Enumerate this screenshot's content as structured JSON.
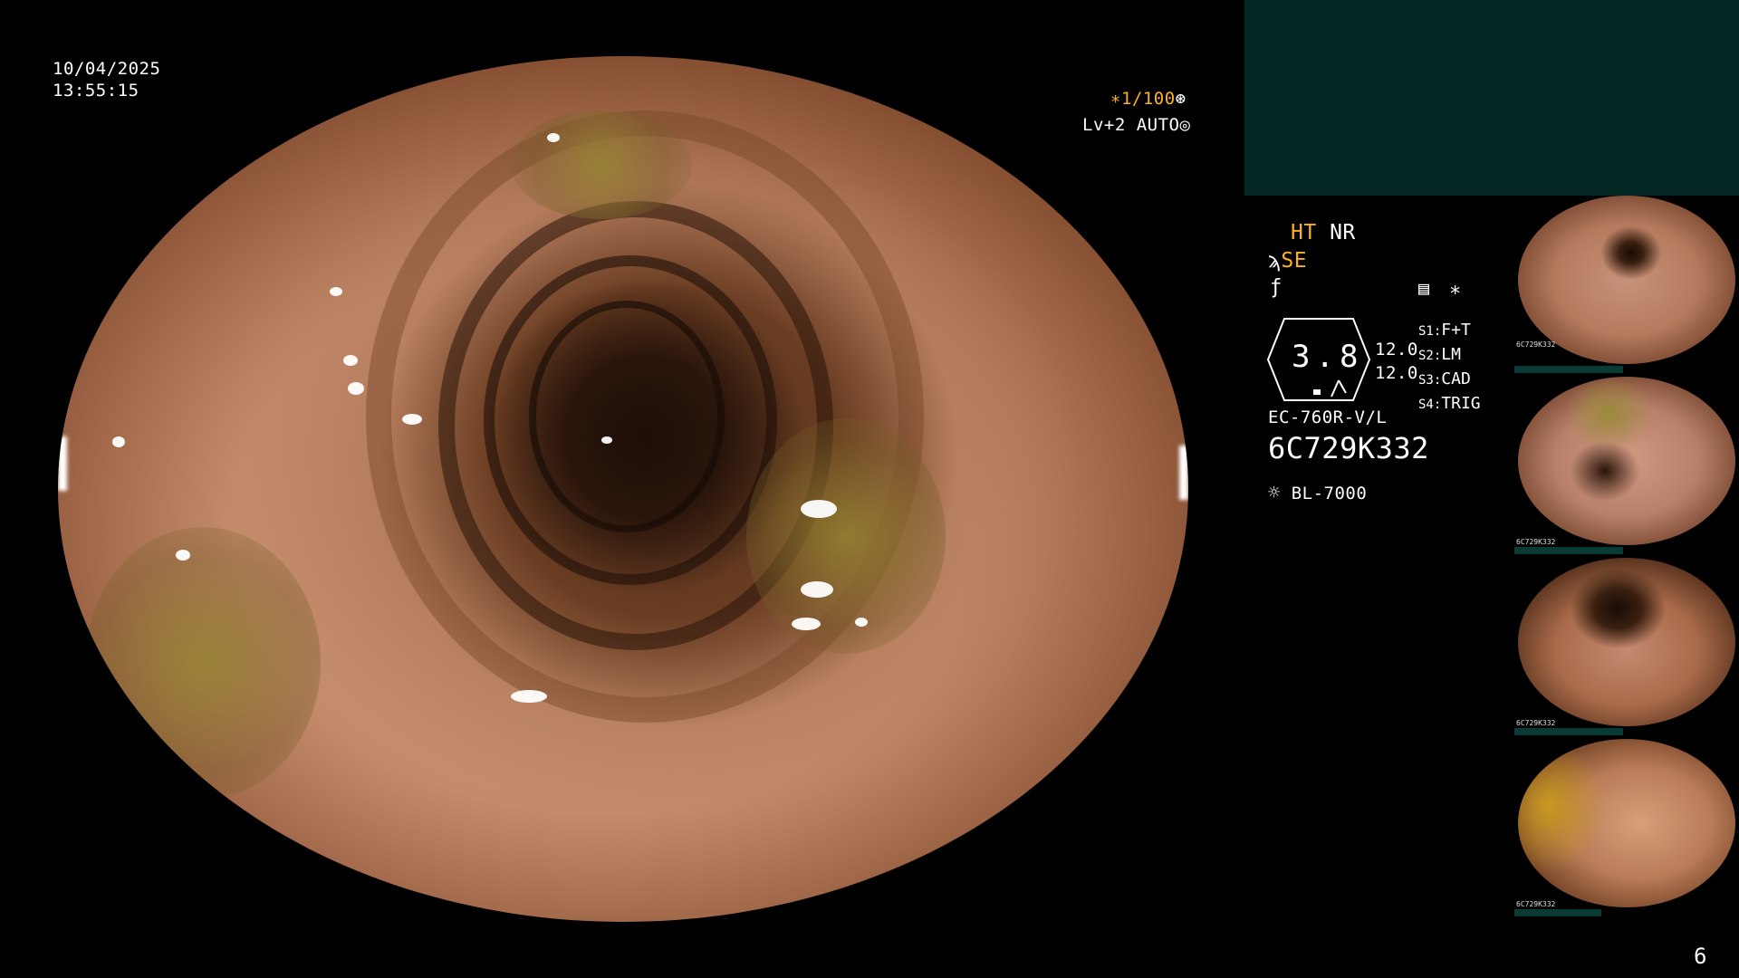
{
  "timestamp": {
    "date": "10/04/2025",
    "time": "13:55:15"
  },
  "overlay": {
    "shutter": "∗1/100",
    "shutter_icon": "aperture-icon",
    "level": "Lv+2",
    "mode": "AUTO",
    "mode_icon": "iris-icon"
  },
  "status": {
    "ht": "HT",
    "nr": "NR",
    "se": "SE",
    "pressure": "3.8",
    "values": [
      "12.0",
      "12.0"
    ],
    "star": "∗",
    "switches": [
      {
        "key": "S1:",
        "value": "F+T"
      },
      {
        "key": "S2:",
        "value": "LM"
      },
      {
        "key": "S3:",
        "value": "CAD"
      },
      {
        "key": "S4:",
        "value": "TRIG"
      }
    ],
    "scope_model": "EC-760R-V/L",
    "serial": "6C729K332",
    "light_source": "BL-7000"
  },
  "thumbnails": [
    {
      "label": "6C729K332"
    },
    {
      "label": "6C729K332"
    },
    {
      "label": "6C729K332"
    },
    {
      "label": "6C729K332"
    }
  ],
  "page_number": "6",
  "colors": {
    "accent": "#ffb020",
    "panel": "#062824",
    "background": "#000000"
  }
}
